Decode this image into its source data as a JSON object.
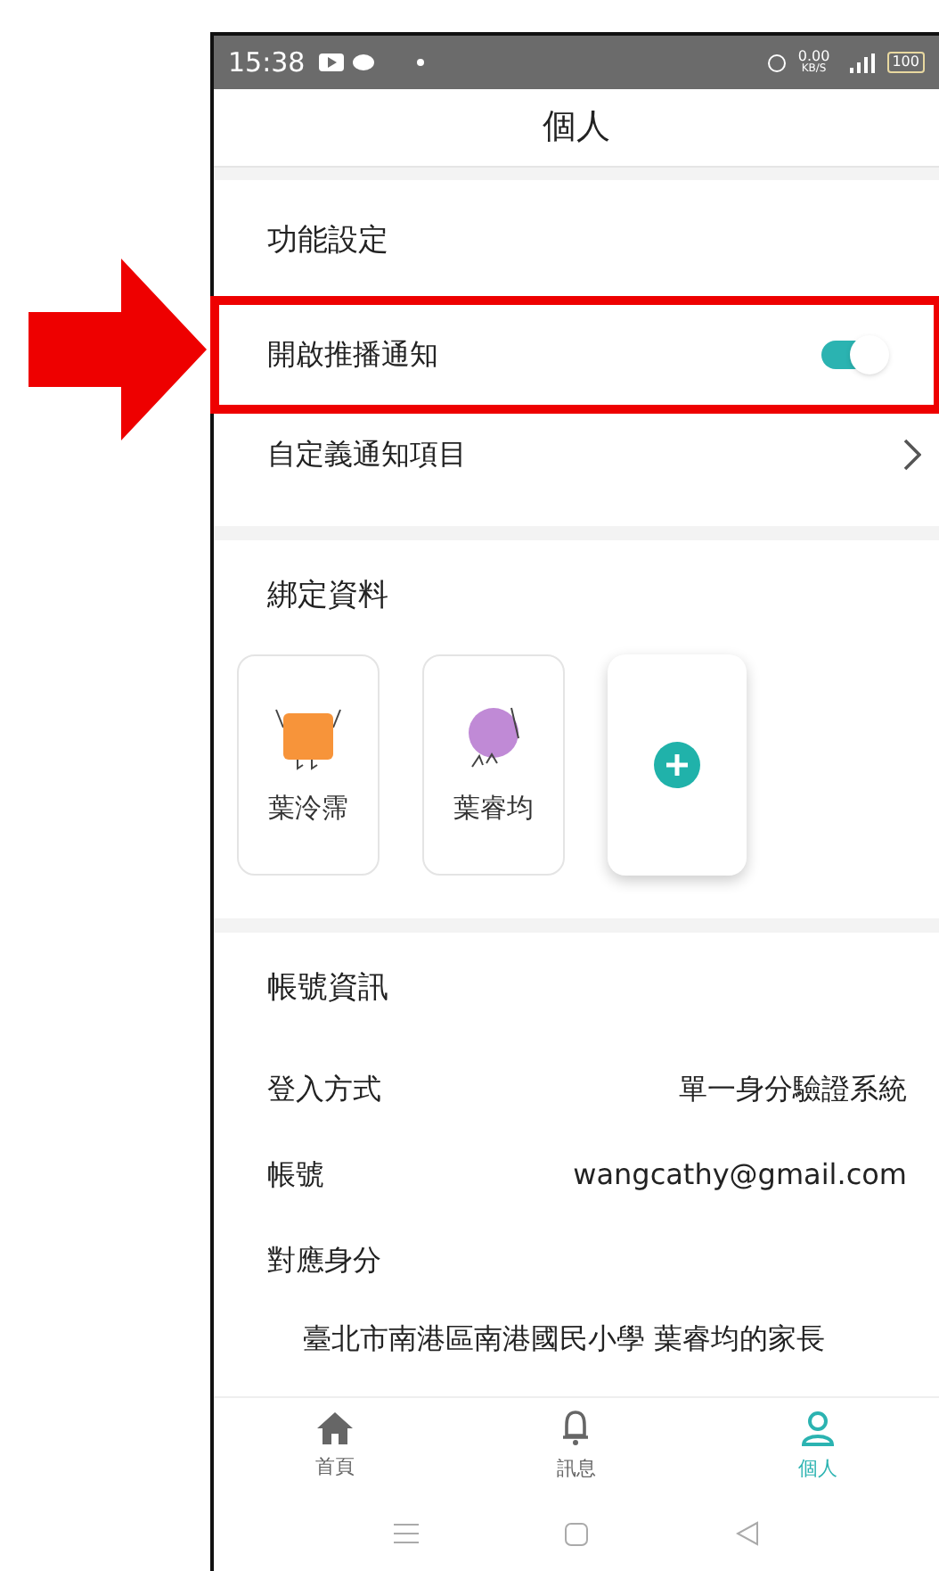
{
  "status_bar": {
    "time": "15:38",
    "net_speed": "0.00",
    "net_unit": "KB/S",
    "battery": "100"
  },
  "header": {
    "title": "個人"
  },
  "feature_settings": {
    "title": "功能設定",
    "items": [
      {
        "kind": "toggle",
        "label": "開啟推播通知",
        "on": true,
        "highlighted": true
      },
      {
        "kind": "link",
        "label": "自定義通知項目"
      }
    ]
  },
  "bound_data": {
    "title": "綁定資料",
    "profiles": [
      {
        "name": "葉泠霈",
        "kind": "square",
        "color": "#f7943a"
      },
      {
        "name": "葉睿均",
        "kind": "circle",
        "color": "#c08ad6"
      }
    ]
  },
  "account_info": {
    "title": "帳號資訊",
    "rows": [
      {
        "label": "登入方式",
        "value": "單一身分驗證系統"
      },
      {
        "label": "帳號",
        "value": "wangcathy@gmail.com"
      },
      {
        "label": "對應身分"
      }
    ],
    "identity": "臺北市南港區南港國民小學 葉睿均的家長"
  },
  "bottom_nav": [
    {
      "label": "首頁",
      "kind": "home",
      "selected": false
    },
    {
      "label": "訊息",
      "kind": "bell",
      "selected": false
    },
    {
      "label": "個人",
      "kind": "person",
      "selected": true
    }
  ]
}
